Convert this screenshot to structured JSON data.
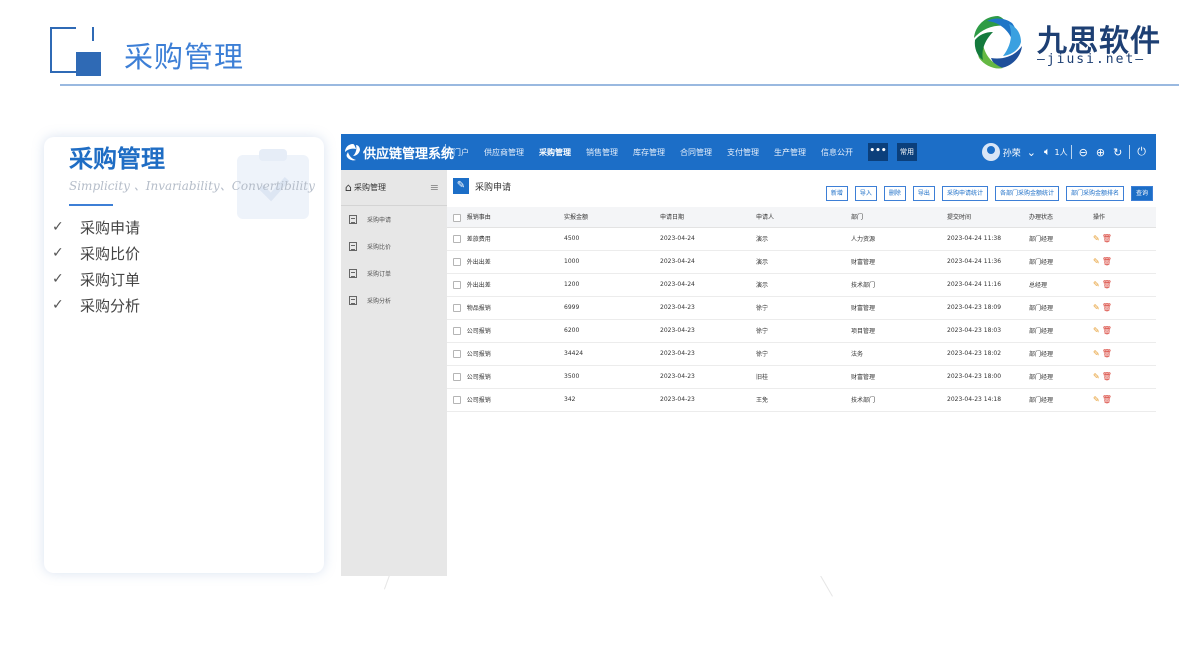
{
  "slide": {
    "title": "采购管理",
    "logo_text": "九思软件",
    "logo_sub": "jiusi.net"
  },
  "card": {
    "title": "采购管理",
    "subtitle": "Simplicity 、Invariability、Convertibility",
    "items": [
      {
        "label": "采购申请"
      },
      {
        "label": "采购比价"
      },
      {
        "label": "采购订单"
      },
      {
        "label": "采购分析"
      }
    ]
  },
  "app": {
    "name": "供应链管理系统",
    "nav": [
      "门户",
      "供应商管理",
      "采购管理",
      "销售管理",
      "库存管理",
      "合同管理",
      "支付管理",
      "生产管理",
      "信息公开"
    ],
    "nav_active": "采购管理",
    "more_label": "•••",
    "common_label": "常用",
    "user": "孙荣",
    "user_extra": "1人",
    "sidebar": {
      "header": "采购管理",
      "items": [
        {
          "label": "采购申请"
        },
        {
          "label": "采购比价"
        },
        {
          "label": "采购订单"
        },
        {
          "label": "采购分析"
        }
      ]
    },
    "page_title": "采购申请",
    "toolbar": [
      "新增",
      "导入",
      "删除",
      "导出",
      "采购申请统计",
      "各部门采购金额统计",
      "部门采购金额排名",
      "查询"
    ],
    "table": {
      "headers": [
        "报销事由",
        "实报金额",
        "申请日期",
        "申请人",
        "部门",
        "提交时间",
        "办理状态",
        "操作"
      ],
      "rows": [
        [
          "差旅费用",
          "4500",
          "2023-04-24",
          "演示",
          "人力资源",
          "2023-04-24 11:38",
          "部门经理"
        ],
        [
          "外出出差",
          "1000",
          "2023-04-24",
          "演示",
          "财富管理",
          "2023-04-24 11:36",
          "部门经理"
        ],
        [
          "外出出差",
          "1200",
          "2023-04-24",
          "演示",
          "技术部门",
          "2023-04-24 11:16",
          "总经理"
        ],
        [
          "物品报销",
          "6999",
          "2023-04-23",
          "徐宁",
          "财富管理",
          "2023-04-23 18:09",
          "部门经理"
        ],
        [
          "公司报销",
          "6200",
          "2023-04-23",
          "徐宁",
          "项目管理",
          "2023-04-23 18:03",
          "部门经理"
        ],
        [
          "公司报销",
          "34424",
          "2023-04-23",
          "徐宁",
          "法务",
          "2023-04-23 18:02",
          "部门经理"
        ],
        [
          "公司报销",
          "3500",
          "2023-04-23",
          "旧桂",
          "财富管理",
          "2023-04-23 18:00",
          "部门经理"
        ],
        [
          "公司报销",
          "342",
          "2023-04-23",
          "王免",
          "技术部门",
          "2023-04-23 14:18",
          "部门经理"
        ]
      ]
    }
  },
  "colors": {
    "brand": "#1c6ec7",
    "title": "#3d7fd6",
    "logo": "#1d3f73",
    "edit": "#e59a2b",
    "delete": "#d9453b"
  },
  "icons": [
    "check-icon",
    "home-icon",
    "menu-icon",
    "doc-icon",
    "edit-icon",
    "delete-icon",
    "avatar",
    "power-icon",
    "refresh-icon"
  ]
}
